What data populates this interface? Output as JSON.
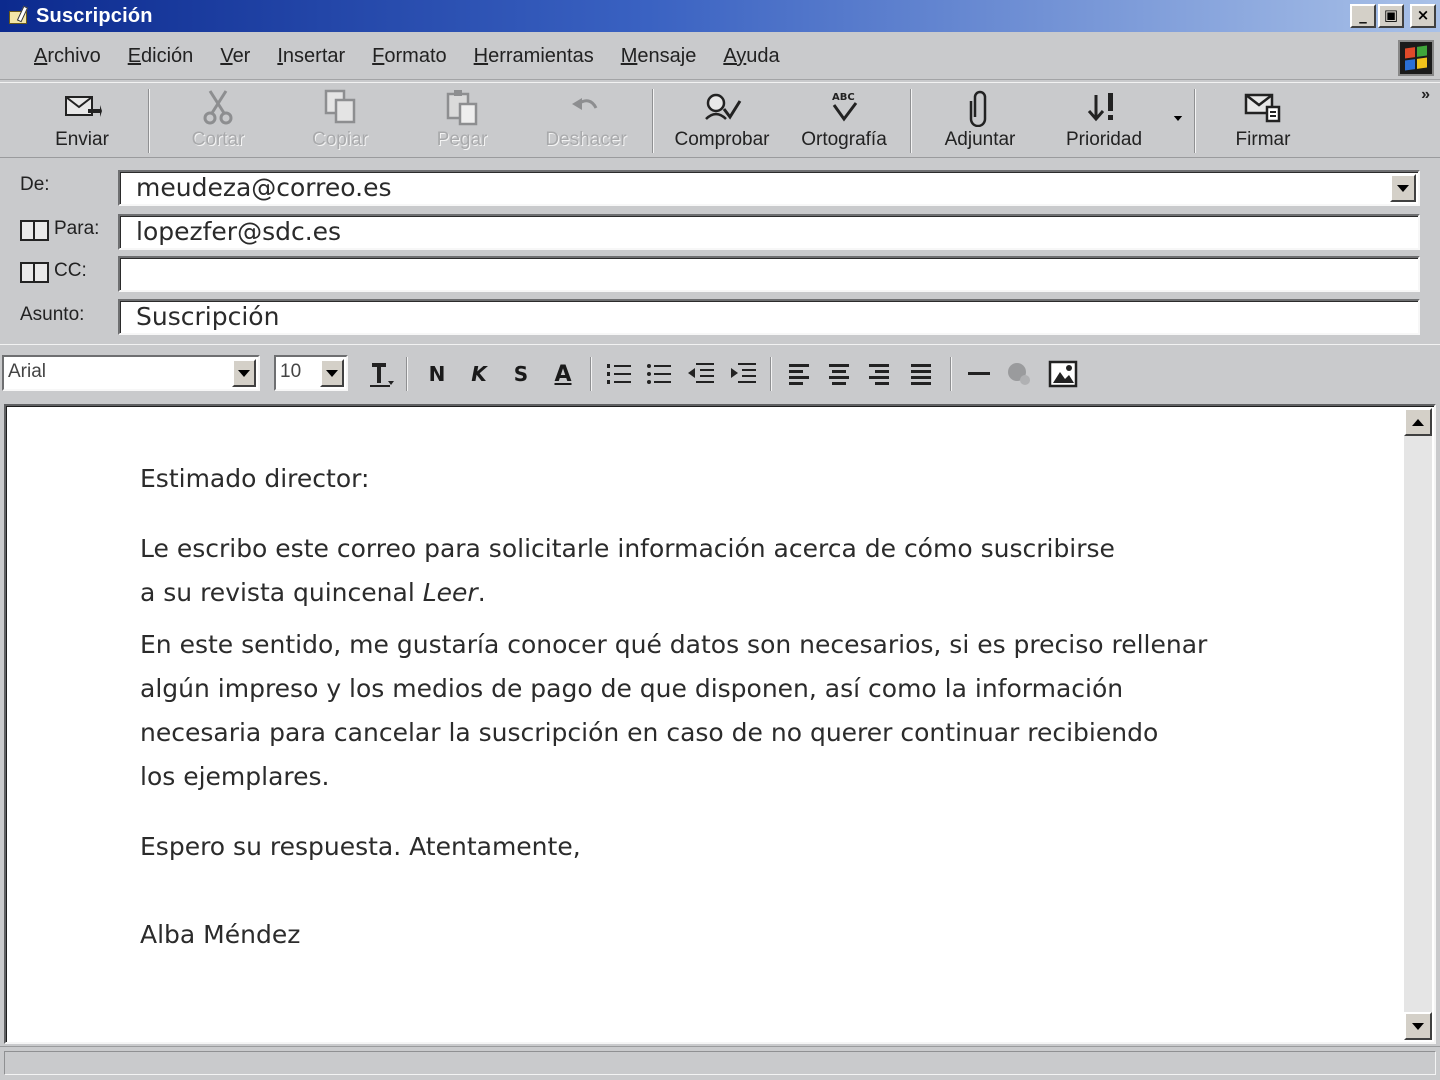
{
  "window": {
    "title": "Suscripción",
    "controls": [
      "_",
      "▣",
      "×"
    ]
  },
  "menu": [
    {
      "u": "A",
      "rest": "rchivo"
    },
    {
      "u": "E",
      "rest": "dición"
    },
    {
      "u": "V",
      "rest": "er"
    },
    {
      "u": "I",
      "rest": "nsertar"
    },
    {
      "u": "F",
      "rest": "ormato"
    },
    {
      "u": "H",
      "rest": "erramientas"
    },
    {
      "u": "M",
      "rest": "ensaje"
    },
    {
      "u": "Ay",
      "rest": "uda",
      "pre": ""
    }
  ],
  "toolbar": {
    "send": "Enviar",
    "cut": "Cortar",
    "copy": "Copiar",
    "paste": "Pegar",
    "undo": "Deshacer",
    "check": "Comprobar",
    "spelling": "Ortografía",
    "attach": "Adjuntar",
    "priority": "Prioridad",
    "sign": "Firmar",
    "more": "»"
  },
  "header": {
    "from_label": "De:",
    "from_value": "meudeza@correo.es",
    "to_label": "Para:",
    "to_value": "lopezfer@sdc.es",
    "cc_label": "CC:",
    "cc_value": "",
    "subject_label": "Asunto:",
    "subject_value": "Suscripción"
  },
  "format": {
    "font": "Arial",
    "size": "10",
    "bold": "N",
    "italic": "K",
    "underline": "S",
    "color": "A"
  },
  "message": {
    "greeting": "Estimado director:",
    "p1_line1": "Le escribo este correo para solicitarle información acerca de cómo suscribirse",
    "p1_line2_pre": "a su revista quincenal ",
    "p1_line2_italic": "Leer",
    "p1_line2_post": ".",
    "p2_line1": "En este sentido, me gustaría conocer qué datos son necesarios, si es preciso rellenar",
    "p2_line2": "algún impreso y los medios de pago de que disponen, así como la información",
    "p2_line3": "necesaria para cancelar la suscripción en caso de no querer continuar recibiendo",
    "p2_line4": "los ejemplares.",
    "closing": "Espero su respuesta. Atentamente,",
    "signature": "Alba Méndez"
  }
}
